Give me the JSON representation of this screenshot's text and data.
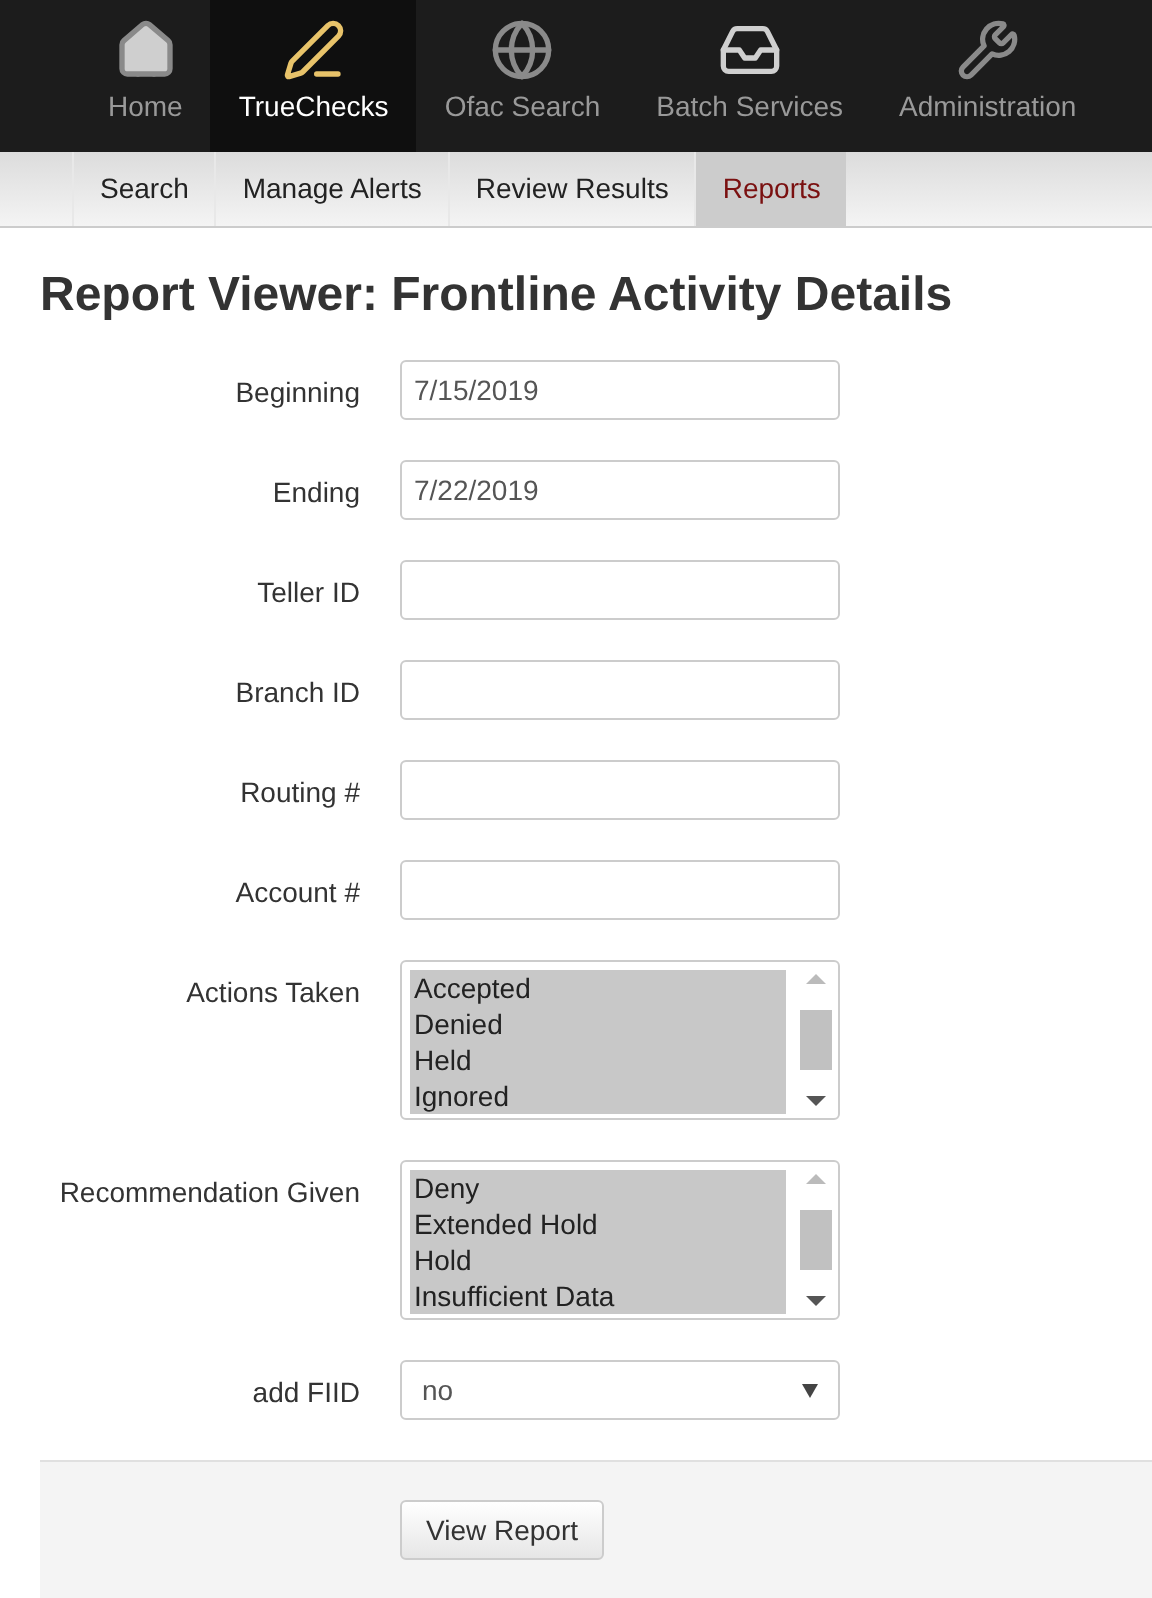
{
  "top_nav": [
    {
      "label": "Home",
      "kind": "home",
      "selected": false
    },
    {
      "label": "TrueChecks",
      "kind": "check",
      "selected": true
    },
    {
      "label": "Ofac Search",
      "kind": "globe",
      "selected": false
    },
    {
      "label": "Batch Services",
      "kind": "tray",
      "selected": false
    },
    {
      "label": "Administration",
      "kind": "tools",
      "selected": false
    }
  ],
  "sub_nav": [
    {
      "label": "Search",
      "selected": false
    },
    {
      "label": "Manage Alerts",
      "selected": false
    },
    {
      "label": "Review Results",
      "selected": false
    },
    {
      "label": "Reports",
      "selected": true
    }
  ],
  "title": "Report Viewer: Frontline Activity Details",
  "fields": [
    {
      "kind": "text",
      "label": "Beginning",
      "value": "7/15/2019"
    },
    {
      "kind": "text",
      "label": "Ending",
      "value": "7/22/2019"
    },
    {
      "kind": "text",
      "label": "Teller ID"
    },
    {
      "kind": "text",
      "label": "Branch ID"
    },
    {
      "kind": "text",
      "label": "Routing #"
    },
    {
      "kind": "text",
      "label": "Account #"
    },
    {
      "kind": "list",
      "label": "Actions Taken",
      "options": [
        {
          "label": "Accepted",
          "selected": true
        },
        {
          "label": "Denied",
          "selected": true
        },
        {
          "label": "Held",
          "selected": true
        },
        {
          "label": "Ignored",
          "selected": true
        }
      ]
    },
    {
      "kind": "list",
      "label": "Recommendation Given",
      "options": [
        {
          "label": "Deny",
          "selected": true
        },
        {
          "label": "Extended Hold",
          "selected": true
        },
        {
          "label": "Hold",
          "selected": true
        },
        {
          "label": "Insufficient Data",
          "selected": true
        }
      ]
    },
    {
      "kind": "select",
      "label": "add FIID",
      "value": "no"
    }
  ],
  "submit": "View Report"
}
